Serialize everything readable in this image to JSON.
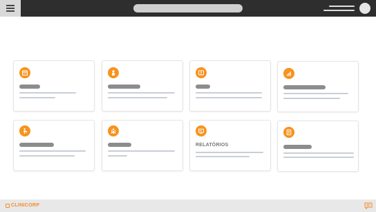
{
  "colors": {
    "accent": "#f7931e",
    "topbar": "#2e2e2e",
    "footer": "#e8e8e8"
  },
  "header": {
    "menu_icon": "hamburger-icon",
    "search_placeholder": "",
    "avatar_icon": "user-avatar"
  },
  "cards": [
    {
      "icon": "calendar-icon",
      "label": ""
    },
    {
      "icon": "person-icon",
      "label": ""
    },
    {
      "icon": "id-card-icon",
      "label": ""
    },
    {
      "icon": "bar-chart-icon",
      "label": ""
    },
    {
      "icon": "walking-person-icon",
      "label": ""
    },
    {
      "icon": "group-icon",
      "label": ""
    },
    {
      "icon": "report-icon",
      "label": "RELATÓRIOS"
    },
    {
      "icon": "document-icon",
      "label": ""
    }
  ],
  "footer": {
    "brand": "CLINICORP",
    "chat_icon": "chat-icon"
  }
}
